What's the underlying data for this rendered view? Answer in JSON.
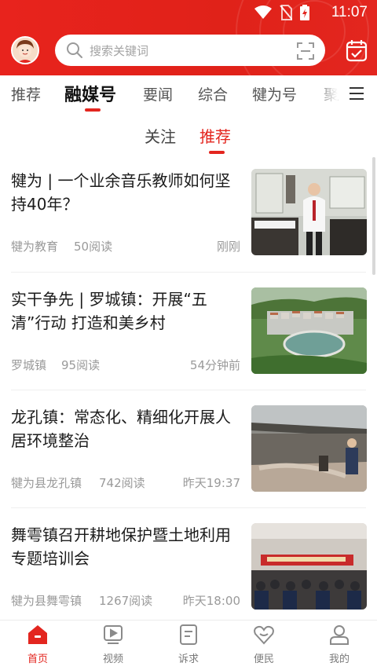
{
  "status_bar": {
    "time": "11:07"
  },
  "search": {
    "placeholder": "搜索关键词"
  },
  "channels": [
    "推荐",
    "融媒号",
    "要闻",
    "综合",
    "犍为号",
    "聚"
  ],
  "sub_tabs": [
    "关注",
    "推荐"
  ],
  "articles": [
    {
      "title": "犍为 | 一个业余音乐教师如何坚持40年？",
      "source": "犍为教育",
      "reads": "50阅读",
      "time": "刚刚"
    },
    {
      "title": "实干争先 | 罗城镇：开展“五清”行动 打造和美乡村",
      "source": "罗城镇",
      "reads": "95阅读",
      "time": "54分钟前"
    },
    {
      "title": "龙孔镇：常态化、精细化开展人居环境整治",
      "source": "犍为县龙孔镇",
      "reads": "742阅读",
      "time": "昨天19:37"
    },
    {
      "title": "舞雩镇召开耕地保护暨土地利用专题培训会",
      "source": "犍为县舞雩镇",
      "reads": "1267阅读",
      "time": "昨天18:00"
    }
  ],
  "bottom_nav": [
    {
      "label": "首页",
      "icon": "home-icon"
    },
    {
      "label": "视频",
      "icon": "video-icon"
    },
    {
      "label": "诉求",
      "icon": "appeal-icon"
    },
    {
      "label": "便民",
      "icon": "heart-icon"
    },
    {
      "label": "我的",
      "icon": "profile-icon"
    }
  ],
  "colors": {
    "brand_red": "#e3261f",
    "text_dark": "#1b1b1b",
    "text_muted": "#9a9a9a"
  }
}
